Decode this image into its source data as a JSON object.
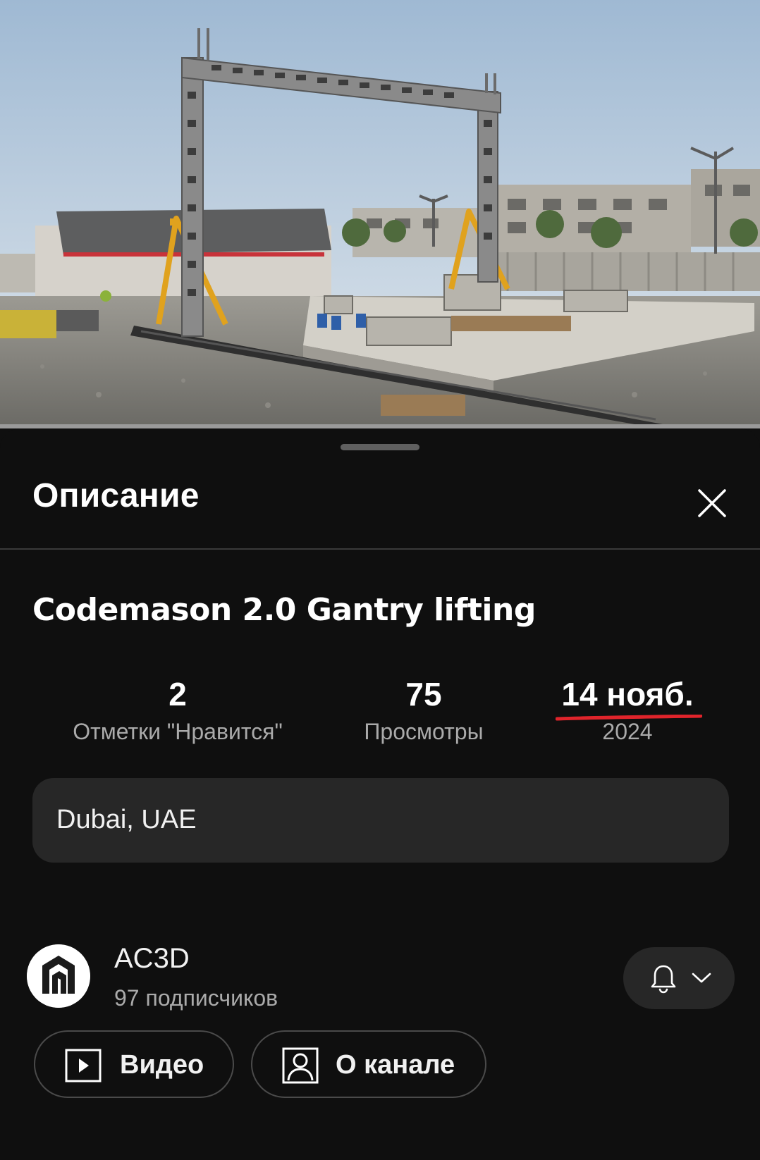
{
  "sheet": {
    "title": "Описание",
    "close_icon": "close-icon"
  },
  "video": {
    "title": "Codemason 2.0 Gantry lifting"
  },
  "stats": {
    "likes_value": "2",
    "likes_label": "Отметки \"Нравится\"",
    "views_value": "75",
    "views_label": "Просмотры",
    "date_value": "14 нояб.",
    "date_year": "2024",
    "underline_color": "#e0242b"
  },
  "location": "Dubai, UAE",
  "channel": {
    "name": "AC3D",
    "subscribers": "97 подписчиков",
    "bell_icon": "bell-icon",
    "chevron_icon": "chevron-down-icon"
  },
  "buttons": {
    "videos_label": "Видео",
    "about_label": "О канале"
  },
  "colors": {
    "background": "#0f0f0f",
    "surface": "#272727",
    "secondary_text": "#aaaaaa"
  }
}
